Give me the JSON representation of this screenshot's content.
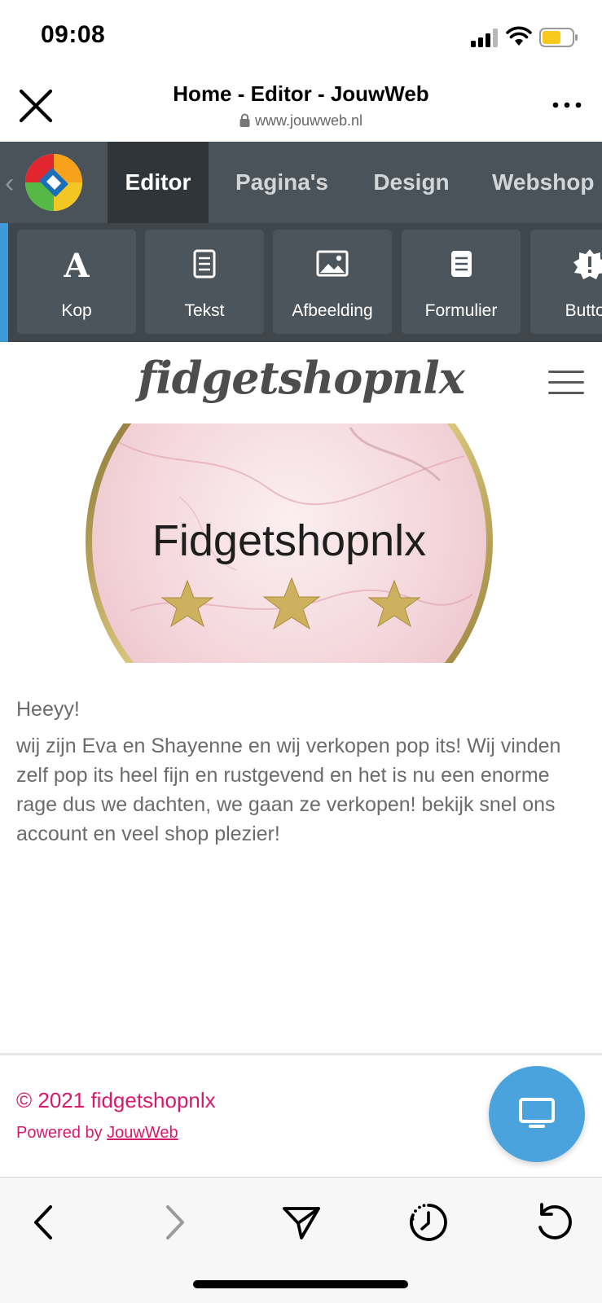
{
  "status": {
    "time": "09:08"
  },
  "browser": {
    "title": "Home - Editor - JouwWeb",
    "url": "www.jouwweb.nl"
  },
  "editor": {
    "tabs": [
      {
        "label": "Editor",
        "active": true
      },
      {
        "label": "Pagina's",
        "active": false
      },
      {
        "label": "Design",
        "active": false
      },
      {
        "label": "Webshop",
        "active": false
      }
    ],
    "tools": [
      {
        "label": "Kop",
        "icon": "heading-icon"
      },
      {
        "label": "Tekst",
        "icon": "text-document-icon"
      },
      {
        "label": "Afbeelding",
        "icon": "image-icon"
      },
      {
        "label": "Formulier",
        "icon": "form-icon"
      },
      {
        "label": "Button",
        "icon": "button-badge-icon"
      }
    ],
    "accent_color": "#3c9ad6"
  },
  "site": {
    "logo_text": "fidgetshopnlx",
    "banner_text": "Fidgetshopnlx",
    "intro": {
      "greeting": "Heeyy!",
      "body": "wij zijn Eva en Shayenne en wij verkopen pop its! Wij vinden zelf pop its heel fijn en rustgevend en het is nu een enorme rage dus we dachten, we gaan ze verkopen! bekijk snel ons account en veel shop plezier!"
    },
    "footer": {
      "copyright": "© 2021 fidgetshopnlx",
      "powered_prefix": "Powered by ",
      "powered_link": "JouwWeb",
      "link_color": "#d61a6b"
    }
  },
  "fab": {
    "icon": "desktop-monitor-icon",
    "color": "#4aa3dc"
  },
  "bottom_nav": [
    {
      "icon": "back-arrow-icon"
    },
    {
      "icon": "forward-arrow-icon"
    },
    {
      "icon": "share-send-icon"
    },
    {
      "icon": "history-clock-icon"
    },
    {
      "icon": "reload-icon"
    }
  ]
}
